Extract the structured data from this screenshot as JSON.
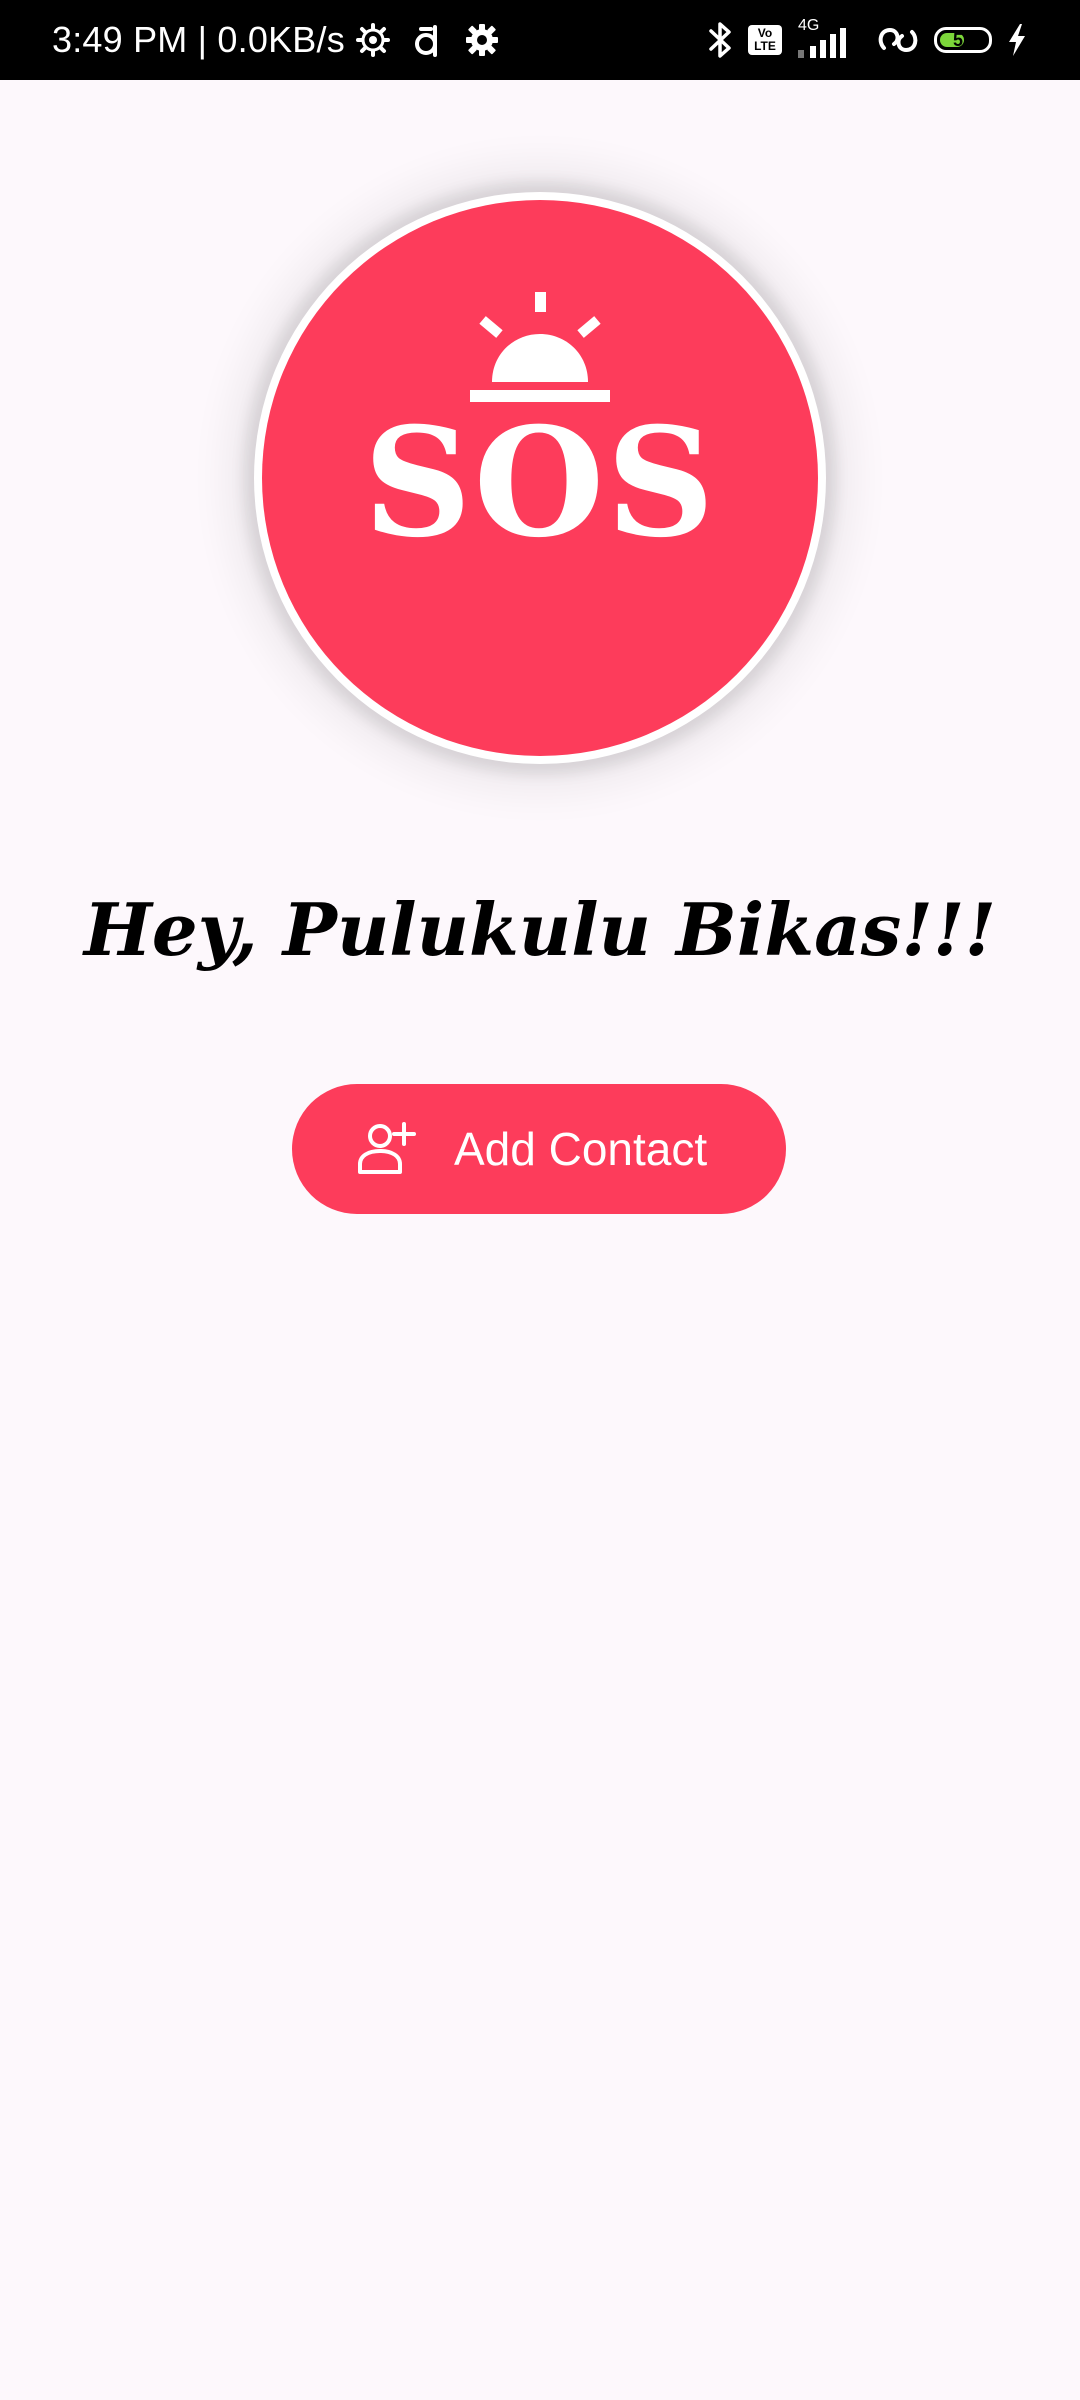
{
  "status_bar": {
    "time_and_speed": "3:49 PM | 0.0KB/s",
    "network_type": "4G",
    "volte_top": "Vo",
    "volte_bottom": "LTE",
    "battery_level": "52",
    "battery_fraction": 0.52,
    "battery_fill_color": "#7cd63a",
    "icons_left": [
      "cog-outline-icon",
      "d-app-icon",
      "settings-gear-icon"
    ],
    "icons_right": [
      "bluetooth-icon",
      "volte-icon",
      "signal-icon",
      "hotspot-link-icon",
      "battery-icon",
      "charging-bolt-icon"
    ]
  },
  "sos": {
    "label": "SOS",
    "icon": "alarm-siren-icon",
    "color": "#fd3c5b"
  },
  "greeting": {
    "text": "Hey, Pulukulu Bikas!!!"
  },
  "add_contact": {
    "label": "Add Contact",
    "icon": "add-person-icon",
    "color": "#fd3c5b"
  },
  "background_color": "#fdf8fc"
}
